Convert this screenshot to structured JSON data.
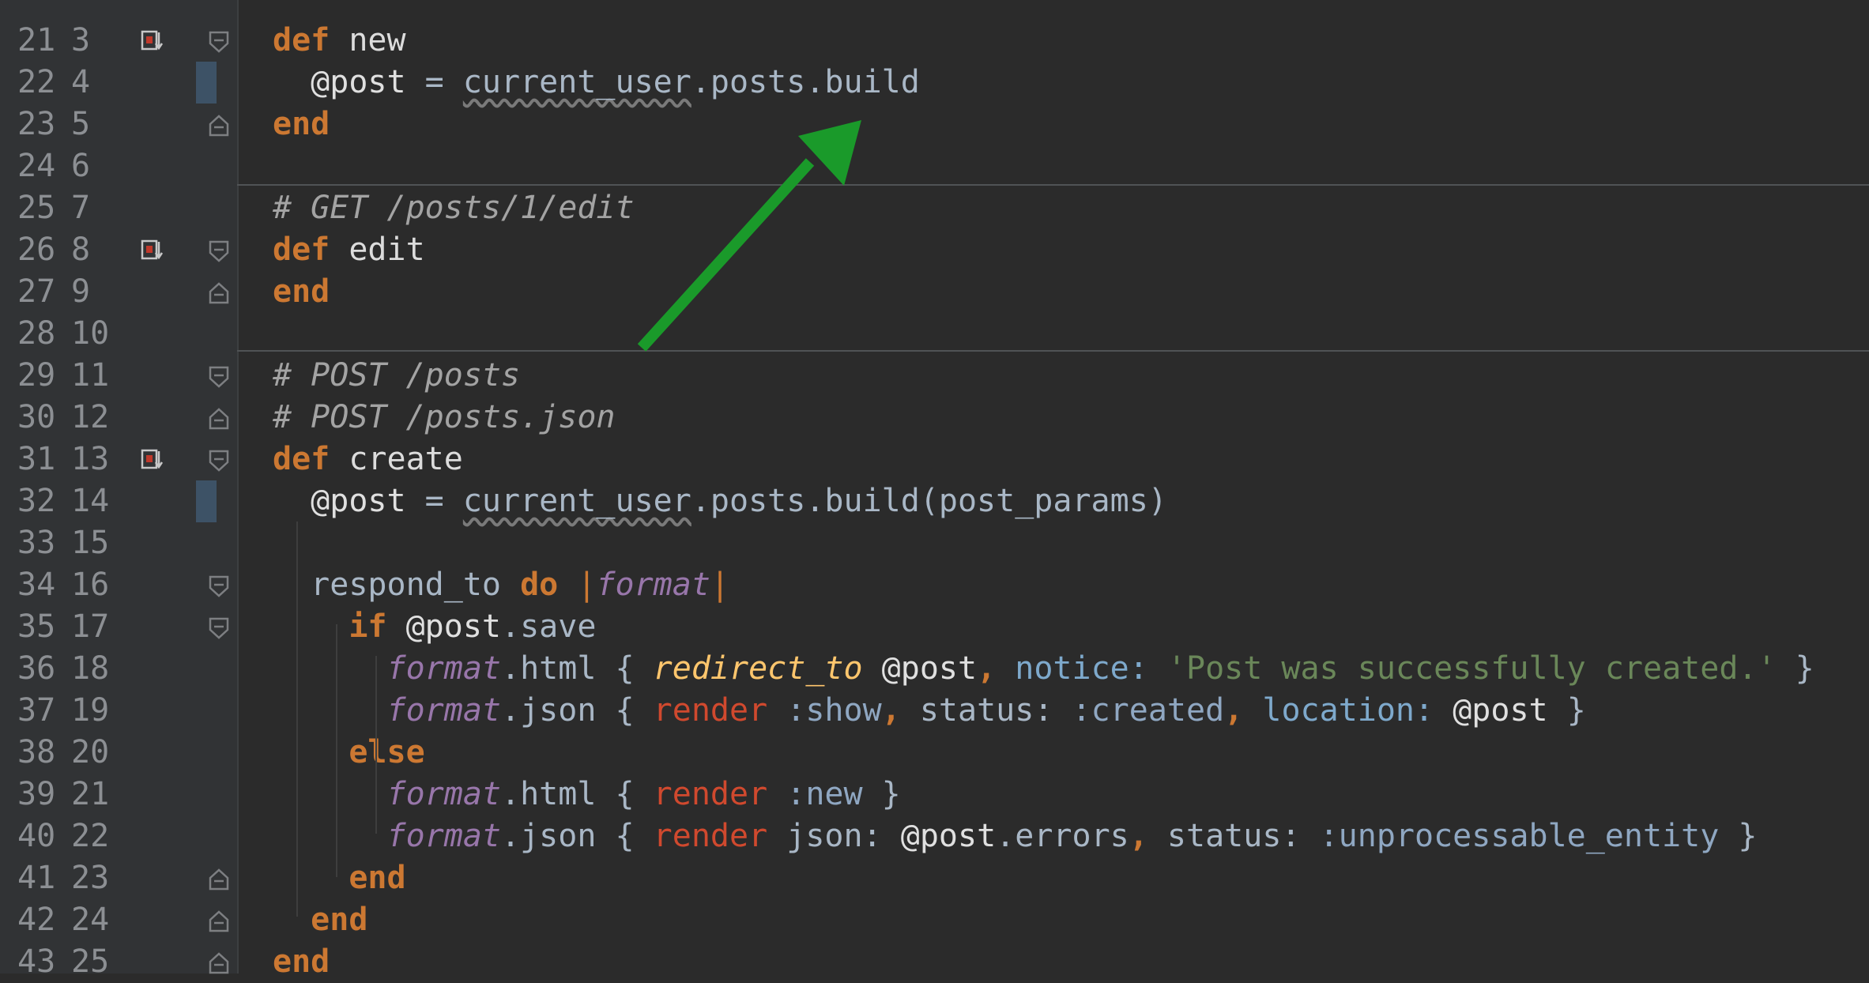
{
  "editor": {
    "lines": [
      {
        "n1": "21",
        "n2": "3",
        "bookmark": true,
        "fold": "open",
        "change": false,
        "code": [
          [
            "kw",
            "def"
          ],
          [
            "plain",
            " "
          ],
          [
            "fn",
            "new"
          ]
        ]
      },
      {
        "n1": "22",
        "n2": "4",
        "bookmark": false,
        "fold": "none",
        "change": true,
        "code": [
          [
            "plain",
            "  "
          ],
          [
            "ivar",
            "@post"
          ],
          [
            "plain",
            " = "
          ],
          [
            "sq",
            "current_user"
          ],
          [
            "plain",
            ".posts.build"
          ]
        ]
      },
      {
        "n1": "23",
        "n2": "5",
        "bookmark": false,
        "fold": "close",
        "change": false,
        "code": [
          [
            "kw",
            "end"
          ]
        ]
      },
      {
        "n1": "24",
        "n2": "6",
        "bookmark": false,
        "fold": "none",
        "change": false,
        "code": []
      },
      {
        "n1": "25",
        "n2": "7",
        "bookmark": false,
        "fold": "none",
        "change": false,
        "code": [
          [
            "comment",
            "# GET /posts/1/edit"
          ]
        ]
      },
      {
        "n1": "26",
        "n2": "8",
        "bookmark": true,
        "fold": "open",
        "change": false,
        "code": [
          [
            "kw",
            "def"
          ],
          [
            "plain",
            " "
          ],
          [
            "fn",
            "edit"
          ]
        ]
      },
      {
        "n1": "27",
        "n2": "9",
        "bookmark": false,
        "fold": "close",
        "change": false,
        "code": [
          [
            "kw",
            "end"
          ]
        ]
      },
      {
        "n1": "28",
        "n2": "10",
        "bookmark": false,
        "fold": "none",
        "change": false,
        "code": []
      },
      {
        "n1": "29",
        "n2": "11",
        "bookmark": false,
        "fold": "open",
        "change": false,
        "code": [
          [
            "comment",
            "# POST /posts"
          ]
        ]
      },
      {
        "n1": "30",
        "n2": "12",
        "bookmark": false,
        "fold": "close",
        "change": false,
        "code": [
          [
            "comment",
            "# POST /posts.json"
          ]
        ]
      },
      {
        "n1": "31",
        "n2": "13",
        "bookmark": true,
        "fold": "open",
        "change": false,
        "code": [
          [
            "kw",
            "def"
          ],
          [
            "plain",
            " "
          ],
          [
            "fn",
            "create"
          ]
        ]
      },
      {
        "n1": "32",
        "n2": "14",
        "bookmark": false,
        "fold": "none",
        "change": true,
        "code": [
          [
            "plain",
            "  "
          ],
          [
            "ivar",
            "@post"
          ],
          [
            "plain",
            " = "
          ],
          [
            "sq",
            "current_user"
          ],
          [
            "plain",
            ".posts.build(post_params)"
          ]
        ]
      },
      {
        "n1": "33",
        "n2": "15",
        "bookmark": false,
        "fold": "none",
        "change": false,
        "code": []
      },
      {
        "n1": "34",
        "n2": "16",
        "bookmark": false,
        "fold": "open",
        "change": false,
        "code": [
          [
            "plain",
            "  respond_to "
          ],
          [
            "kw",
            "do"
          ],
          [
            "plain",
            " "
          ],
          [
            "pipe",
            "|"
          ],
          [
            "param",
            "format"
          ],
          [
            "pipe",
            "|"
          ]
        ]
      },
      {
        "n1": "35",
        "n2": "17",
        "bookmark": false,
        "fold": "open",
        "change": false,
        "code": [
          [
            "plain",
            "    "
          ],
          [
            "kw",
            "if"
          ],
          [
            "plain",
            " "
          ],
          [
            "ivar",
            "@post"
          ],
          [
            "plain",
            ".save"
          ]
        ]
      },
      {
        "n1": "36",
        "n2": "18",
        "bookmark": false,
        "fold": "none",
        "change": false,
        "code": [
          [
            "plain",
            "      "
          ],
          [
            "param",
            "format"
          ],
          [
            "plain",
            ".html { "
          ],
          [
            "ital",
            "redirect_to"
          ],
          [
            "plain",
            " "
          ],
          [
            "ivar",
            "@post"
          ],
          [
            "kw",
            ","
          ],
          [
            "plain",
            " "
          ],
          [
            "hashkey",
            "notice:"
          ],
          [
            "plain",
            " "
          ],
          [
            "str",
            "'Post was successfully created.'"
          ],
          [
            "plain",
            " }"
          ]
        ]
      },
      {
        "n1": "37",
        "n2": "19",
        "bookmark": false,
        "fold": "none",
        "change": false,
        "code": [
          [
            "plain",
            "      "
          ],
          [
            "param",
            "format"
          ],
          [
            "plain",
            ".json { "
          ],
          [
            "render",
            "render"
          ],
          [
            "plain",
            " "
          ],
          [
            "sym",
            ":show"
          ],
          [
            "kw",
            ","
          ],
          [
            "plain",
            " status: "
          ],
          [
            "sym",
            ":created"
          ],
          [
            "kw",
            ","
          ],
          [
            "plain",
            " "
          ],
          [
            "hashkey",
            "location:"
          ],
          [
            "plain",
            " "
          ],
          [
            "ivar",
            "@post"
          ],
          [
            "plain",
            " }"
          ]
        ]
      },
      {
        "n1": "38",
        "n2": "20",
        "bookmark": false,
        "fold": "none",
        "change": false,
        "code": [
          [
            "plain",
            "    "
          ],
          [
            "kw",
            "else"
          ]
        ]
      },
      {
        "n1": "39",
        "n2": "21",
        "bookmark": false,
        "fold": "none",
        "change": false,
        "code": [
          [
            "plain",
            "      "
          ],
          [
            "param",
            "format"
          ],
          [
            "plain",
            ".html { "
          ],
          [
            "render",
            "render"
          ],
          [
            "plain",
            " "
          ],
          [
            "sym",
            ":new"
          ],
          [
            "plain",
            " }"
          ]
        ]
      },
      {
        "n1": "40",
        "n2": "22",
        "bookmark": false,
        "fold": "none",
        "change": false,
        "code": [
          [
            "plain",
            "      "
          ],
          [
            "param",
            "format"
          ],
          [
            "plain",
            ".json { "
          ],
          [
            "render",
            "render"
          ],
          [
            "plain",
            " json: "
          ],
          [
            "ivar",
            "@post"
          ],
          [
            "plain",
            ".errors"
          ],
          [
            "kw",
            ","
          ],
          [
            "plain",
            " status: "
          ],
          [
            "sym",
            ":unprocessable_entity"
          ],
          [
            "plain",
            " }"
          ]
        ]
      },
      {
        "n1": "41",
        "n2": "23",
        "bookmark": false,
        "fold": "close",
        "change": false,
        "code": [
          [
            "plain",
            "    "
          ],
          [
            "kw",
            "end"
          ]
        ]
      },
      {
        "n1": "42",
        "n2": "24",
        "bookmark": false,
        "fold": "close",
        "change": false,
        "code": [
          [
            "plain",
            "  "
          ],
          [
            "kw",
            "end"
          ]
        ]
      },
      {
        "n1": "43",
        "n2": "25",
        "bookmark": false,
        "fold": "close",
        "change": false,
        "code": [
          [
            "kw",
            "end"
          ]
        ]
      }
    ]
  },
  "annotation": {
    "color": "#1a9a2a"
  },
  "colors": {
    "background": "#2b2b2b",
    "gutter": "#313335",
    "keyword": "#cc7832",
    "string": "#6a8759",
    "comment": "#a3a3a3"
  }
}
